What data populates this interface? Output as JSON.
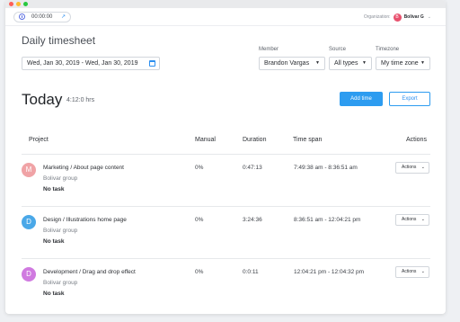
{
  "timer": {
    "time": "00:00:00",
    "clock_icon": "clock-icon",
    "open_icon": "arrow-up-right-icon"
  },
  "organization": {
    "label": "Organization:",
    "badge": "B",
    "name": "Bolivar G",
    "badge_color": "#e8516e"
  },
  "page": {
    "title": "Daily timesheet"
  },
  "filters": {
    "date_range": "Wed, Jan 30, 2019 - Wed, Jan 30, 2019",
    "member_label": "Member",
    "member_value": "Brandon Vargas",
    "source_label": "Source",
    "source_value": "All types",
    "timezone_label": "Timezone",
    "timezone_value": "My time zone"
  },
  "summary": {
    "label": "Today",
    "total": "4:12:0 hrs"
  },
  "actions": {
    "add_time": "Add time",
    "export": "Export"
  },
  "table": {
    "headers": {
      "project": "Project",
      "manual": "Manual",
      "duration": "Duration",
      "time_span": "Time span",
      "actions": "Actions"
    },
    "rows": [
      {
        "initial": "M",
        "color": "#f0a3a6",
        "title": "Marketing / About page content",
        "group": "Bolivar group",
        "task": "No task",
        "manual": "0%",
        "duration": "0:47:13",
        "time_span": "7:49:38 am - 8:36:51 am",
        "action": "Actions"
      },
      {
        "initial": "D",
        "color": "#4aa8e8",
        "title": "Design / Illustrations home page",
        "group": "Bolivar group",
        "task": "No task",
        "manual": "0%",
        "duration": "3:24:36",
        "time_span": "8:36:51 am - 12:04:21 pm",
        "action": "Actions"
      },
      {
        "initial": "D",
        "color": "#d07ae0",
        "title": "Development / Drag and drop effect",
        "group": "Bolivar group",
        "task": "No task",
        "manual": "0%",
        "duration": "0:0:11",
        "time_span": "12:04:21 pm - 12:04:32 pm",
        "action": "Actions"
      }
    ]
  },
  "colors": {
    "accent": "#2d9cf0"
  }
}
